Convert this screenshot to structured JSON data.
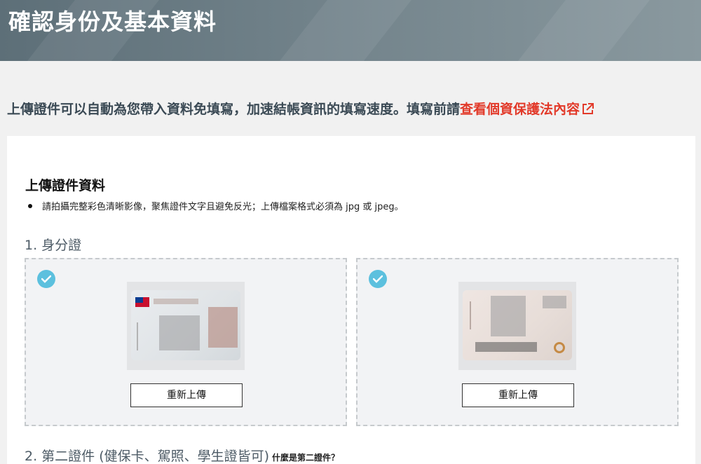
{
  "header": {
    "title": "確認身份及基本資料"
  },
  "intro": {
    "text": "上傳證件可以自動為您帶入資料免填寫，加速結帳資訊的填寫速度。填寫前請",
    "link_text": "查看個資保護法內容",
    "link_icon": "external-link-icon"
  },
  "upload_card": {
    "title": "上傳證件資料",
    "instruction": "請拍攝完整彩色清晰影像，聚焦證件文字且避免反光；上傳檔案格式必須為 jpg 或 jpeg。",
    "section1": {
      "title": "1. 身分證"
    },
    "front": {
      "status_icon": "check-circle-icon",
      "button_label": "重新上傳"
    },
    "back": {
      "status_icon": "check-circle-icon",
      "button_label": "重新上傳"
    },
    "section2": {
      "title": "2. 第二證件 (健保卡、駕照、學生證皆可)",
      "hint": "什麼是第二證件？"
    }
  },
  "colors": {
    "accent": "#e23a2a",
    "check": "#5cc0de",
    "banner": "#6f8088"
  }
}
